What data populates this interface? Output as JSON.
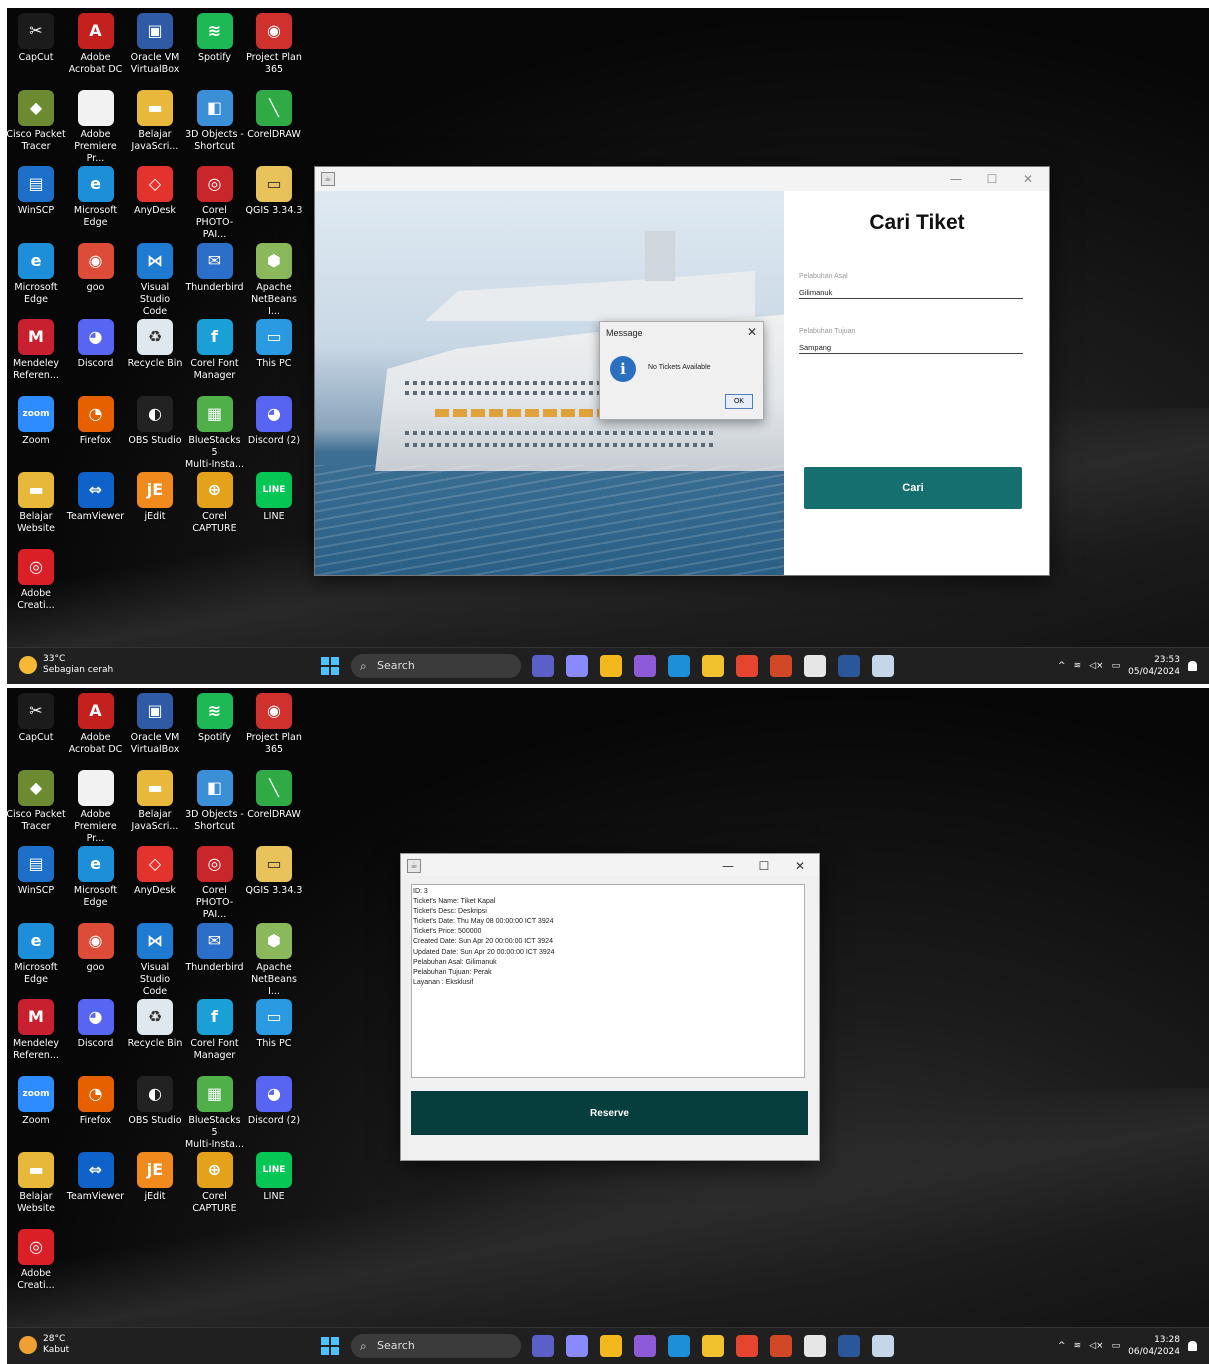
{
  "desktop_icons": [
    {
      "label1": "CapCut",
      "label2": "",
      "color": "#1b1b1b",
      "glyph": "✂"
    },
    {
      "label1": "Adobe",
      "label2": "Acrobat DC",
      "color": "#c4201d",
      "glyph": "A"
    },
    {
      "label1": "Oracle VM",
      "label2": "VirtualBox",
      "color": "#2f5aa5",
      "glyph": "▣"
    },
    {
      "label1": "Spotify",
      "label2": "",
      "color": "#1db954",
      "glyph": "≋"
    },
    {
      "label1": "Project Plan",
      "label2": "365",
      "color": "#d0312d",
      "glyph": "◉"
    },
    {
      "label1": "Cisco Packet",
      "label2": "Tracer",
      "color": "#6c8a2f",
      "glyph": "◆"
    },
    {
      "label1": "Adobe",
      "label2": "Premiere Pr...",
      "color": "#f2f2f2",
      "glyph": ""
    },
    {
      "label1": "Belajar",
      "label2": "JavaScri...",
      "color": "#e8b83a",
      "glyph": "▬"
    },
    {
      "label1": "3D Objects -",
      "label2": "Shortcut",
      "color": "#3a8fd6",
      "glyph": "◧"
    },
    {
      "label1": "CorelDRAW",
      "label2": "",
      "color": "#2faa45",
      "glyph": "╲"
    },
    {
      "label1": "WinSCP",
      "label2": "",
      "color": "#1e6fc8",
      "glyph": "▤"
    },
    {
      "label1": "Microsoft",
      "label2": "Edge",
      "color": "#1c8fd8",
      "glyph": "e"
    },
    {
      "label1": "AnyDesk",
      "label2": "",
      "color": "#e3332c",
      "glyph": "◇"
    },
    {
      "label1": "Corel",
      "label2": "PHOTO-PAI...",
      "color": "#c8262b",
      "glyph": "◎"
    },
    {
      "label1": "QGIS 3.34.3",
      "label2": "",
      "color": "#e8c25a",
      "glyph": "▭"
    },
    {
      "label1": "Microsoft",
      "label2": "Edge",
      "color": "#1c8fd8",
      "glyph": "e"
    },
    {
      "label1": "goo",
      "label2": "",
      "color": "#dd4b39",
      "glyph": "◉"
    },
    {
      "label1": "Visual Studio",
      "label2": "Code",
      "color": "#1f7bd2",
      "glyph": "⋈"
    },
    {
      "label1": "Thunderbird",
      "label2": "",
      "color": "#2b6fc9",
      "glyph": "✉"
    },
    {
      "label1": "Apache",
      "label2": "NetBeans I...",
      "color": "#8ab85a",
      "glyph": "⬢"
    },
    {
      "label1": "Mendeley",
      "label2": "Referen...",
      "color": "#c8202f",
      "glyph": "M"
    },
    {
      "label1": "Discord",
      "label2": "",
      "color": "#5865f2",
      "glyph": "◕"
    },
    {
      "label1": "Recycle Bin",
      "label2": "",
      "color": "#dfe8ee",
      "glyph": "♻"
    },
    {
      "label1": "Corel Font",
      "label2": "Manager",
      "color": "#1aa0d6",
      "glyph": "f"
    },
    {
      "label1": "This PC",
      "label2": "",
      "color": "#2a9ae3",
      "glyph": "▭"
    },
    {
      "label1": "Zoom",
      "label2": "",
      "color": "#2d8cff",
      "glyph": "zoom"
    },
    {
      "label1": "Firefox",
      "label2": "",
      "color": "#e66000",
      "glyph": "◔"
    },
    {
      "label1": "OBS Studio",
      "label2": "",
      "color": "#222222",
      "glyph": "◐"
    },
    {
      "label1": "BlueStacks 5",
      "label2": "Multi-Insta...",
      "color": "#4fb04a",
      "glyph": "▦"
    },
    {
      "label1": "Discord (2)",
      "label2": "",
      "color": "#5865f2",
      "glyph": "◕"
    },
    {
      "label1": "Belajar",
      "label2": "Website",
      "color": "#e8b83a",
      "glyph": "▬"
    },
    {
      "label1": "TeamViewer",
      "label2": "",
      "color": "#0e62c9",
      "glyph": "⇔"
    },
    {
      "label1": "jEdit",
      "label2": "",
      "color": "#f08a1c",
      "glyph": "jE"
    },
    {
      "label1": "Corel",
      "label2": "CAPTURE",
      "color": "#e3a21a",
      "glyph": "⊕"
    },
    {
      "label1": "LINE",
      "label2": "",
      "color": "#06c755",
      "glyph": "LINE"
    },
    {
      "label1": "Adobe",
      "label2": "Creati...",
      "color": "#da1f26",
      "glyph": "◎"
    }
  ],
  "shot1": {
    "weather": {
      "temp": "33°C",
      "desc": "Sebagian cerah"
    },
    "search": "Search",
    "clock": {
      "time": "23:53",
      "date": "05/04/2024"
    },
    "window": {
      "form_title": "Cari Tiket",
      "origin_label": "Pelabuhan Asal",
      "origin_value": "Gilimanuk",
      "dest_label": "Pelabuhan Tujuan",
      "dest_value": "Sampang",
      "search_button": "Cari"
    },
    "dialog": {
      "title": "Message",
      "message": "No Tickets Available",
      "ok": "OK"
    }
  },
  "shot2": {
    "weather": {
      "temp": "28°C",
      "desc": "Kabut"
    },
    "search": "Search",
    "clock": {
      "time": "13:28",
      "date": "06/04/2024"
    },
    "window": {
      "details": [
        "ID: 3",
        "Ticket's Name: Tiket Kapal",
        "Ticket's Desc: Deskripsi",
        "Ticket's Date: Thu May 08 00:00:00 ICT 3924",
        "Ticket's Price: 500000",
        "Created Date: Sun Apr 20 00:00:00 ICT 3924",
        "Updated Date: Sun Apr 20 00:00:00 ICT 3924",
        "Pelabuhan Asal: Gilimanuk",
        "Pelabuhan Tujuan: Perak",
        "Layanan : Eksklusif"
      ],
      "reserve_button": "Reserve"
    }
  },
  "taskbar_apps": [
    {
      "name": "teams-icon",
      "color": "#5b5fc7"
    },
    {
      "name": "store-icon",
      "color": "#8a8aff"
    },
    {
      "name": "chrome-icon",
      "color": "#f2b81d"
    },
    {
      "name": "visual-studio-icon",
      "color": "#8d5bd8"
    },
    {
      "name": "edge-icon",
      "color": "#1c8fd8"
    },
    {
      "name": "file-explorer-icon",
      "color": "#f2c12e"
    },
    {
      "name": "chrome-alt-icon",
      "color": "#e5442f"
    },
    {
      "name": "powerpoint-icon",
      "color": "#d24726"
    },
    {
      "name": "app-icon",
      "color": "#e6e6e6"
    },
    {
      "name": "word-icon",
      "color": "#2b579a"
    },
    {
      "name": "java-icon",
      "color": "#c5d6e8"
    }
  ]
}
